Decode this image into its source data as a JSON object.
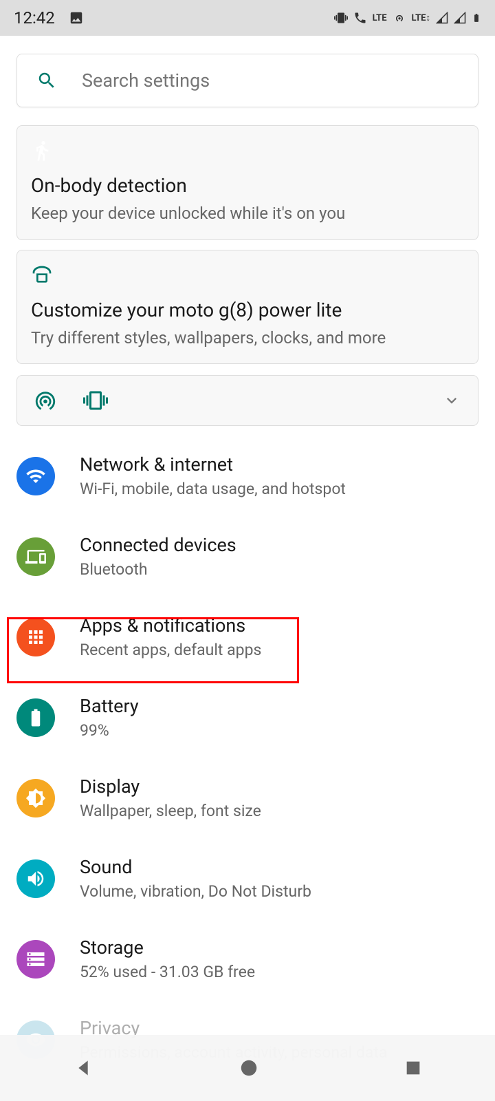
{
  "statusbar": {
    "time": "12:42",
    "lte": "LTE",
    "lte2": "LTE↕"
  },
  "search": {
    "placeholder": "Search settings"
  },
  "cards": {
    "onbody": {
      "title": "On-body detection",
      "subtitle": "Keep your device unlocked while it's on you"
    },
    "customize": {
      "title": "Customize your moto g(8) power lite",
      "subtitle": "Try different styles, wallpapers, clocks, and more"
    }
  },
  "settings": {
    "network": {
      "title": "Network & internet",
      "subtitle": "Wi-Fi, mobile, data usage, and hotspot",
      "color": "#1a73e8"
    },
    "connected": {
      "title": "Connected devices",
      "subtitle": "Bluetooth",
      "color": "#689f38"
    },
    "apps": {
      "title": "Apps & notifications",
      "subtitle": "Recent apps, default apps",
      "color": "#f4511e"
    },
    "battery": {
      "title": "Battery",
      "subtitle": "99%",
      "color": "#00897b"
    },
    "display": {
      "title": "Display",
      "subtitle": "Wallpaper, sleep, font size",
      "color": "#f6a821"
    },
    "sound": {
      "title": "Sound",
      "subtitle": "Volume, vibration, Do Not Disturb",
      "color": "#00acc1"
    },
    "storage": {
      "title": "Storage",
      "subtitle": "52% used - 31.03 GB free",
      "color": "#ab47bc"
    },
    "privacy": {
      "title": "Privacy",
      "subtitle": "Permissions, account activity, personal data",
      "color": "#6ab7d0"
    }
  }
}
